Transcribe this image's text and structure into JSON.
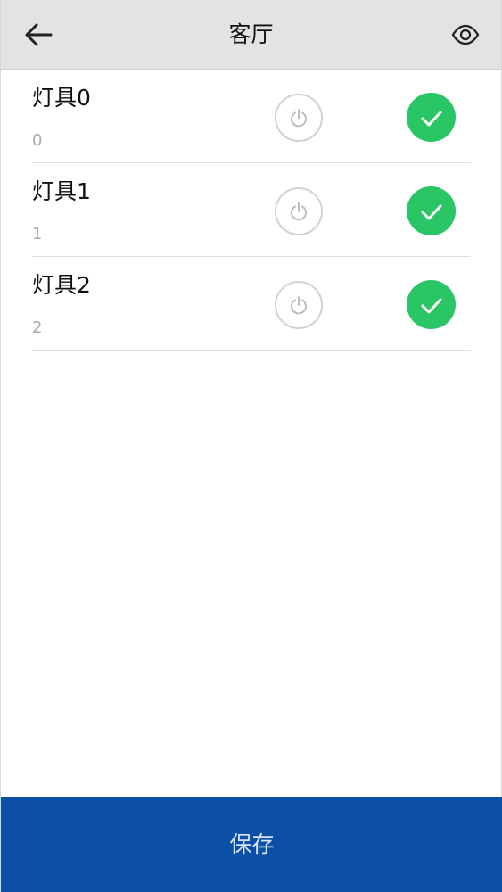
{
  "theme": {
    "navbar_bg": "#e3e3e5",
    "check_green": "#2ac665",
    "save_blue": "#0b4fa6"
  },
  "header": {
    "title": "客厅",
    "back_icon": "arrow-left-icon",
    "eye_icon": "eye-icon"
  },
  "list": {
    "items": [
      {
        "title": "灯具0",
        "subtitle": "0",
        "power_icon": "power-icon",
        "check_icon": "check-icon",
        "selected": true
      },
      {
        "title": "灯具1",
        "subtitle": "1",
        "power_icon": "power-icon",
        "check_icon": "check-icon",
        "selected": true
      },
      {
        "title": "灯具2",
        "subtitle": "2",
        "power_icon": "power-icon",
        "check_icon": "check-icon",
        "selected": true
      }
    ]
  },
  "footer": {
    "save_label": "保存"
  }
}
